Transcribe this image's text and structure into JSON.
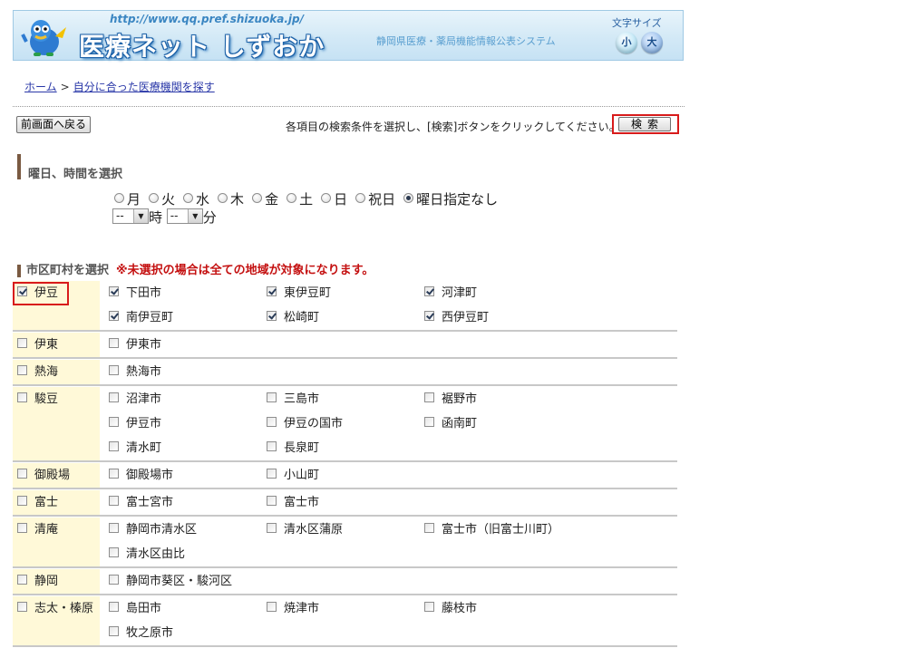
{
  "header": {
    "url": "http://www.qq.pref.shizuoka.jp/",
    "site_title": "医療ネット しずおか",
    "subtitle": "静岡県医療・薬局機能情報公表システム",
    "font_size_label": "文字サイズ",
    "font_small": "小",
    "font_large": "大"
  },
  "breadcrumb": {
    "home": "ホーム",
    "sep": ">",
    "current": "自分に合った医療機関を探す"
  },
  "controls": {
    "back_label": "前画面へ戻る",
    "instruction": "各項目の検索条件を選択し、[検索]ボタンをクリックしてください。→",
    "search_label": "検索"
  },
  "days_section": {
    "heading": "曜日、時間を選択",
    "options": [
      {
        "label": "月",
        "checked": false
      },
      {
        "label": "火",
        "checked": false
      },
      {
        "label": "水",
        "checked": false
      },
      {
        "label": "木",
        "checked": false
      },
      {
        "label": "金",
        "checked": false
      },
      {
        "label": "土",
        "checked": false
      },
      {
        "label": "日",
        "checked": false
      },
      {
        "label": "祝日",
        "checked": false
      },
      {
        "label": "曜日指定なし",
        "checked": true
      }
    ],
    "hour_value": "--",
    "hour_unit": "時",
    "minute_value": "--",
    "minute_unit": "分"
  },
  "area_section": {
    "heading": "市区町村を選択",
    "note": "※未選択の場合は全ての地域が対象になります。",
    "regions": [
      {
        "name": "伊豆",
        "checked": true,
        "munis": [
          {
            "name": "下田市",
            "checked": true
          },
          {
            "name": "東伊豆町",
            "checked": true
          },
          {
            "name": "河津町",
            "checked": true
          },
          {
            "name": "南伊豆町",
            "checked": true
          },
          {
            "name": "松崎町",
            "checked": true
          },
          {
            "name": "西伊豆町",
            "checked": true
          }
        ]
      },
      {
        "name": "伊東",
        "checked": false,
        "munis": [
          {
            "name": "伊東市",
            "checked": false
          }
        ]
      },
      {
        "name": "熱海",
        "checked": false,
        "munis": [
          {
            "name": "熱海市",
            "checked": false
          }
        ]
      },
      {
        "name": "駿豆",
        "checked": false,
        "munis": [
          {
            "name": "沼津市",
            "checked": false
          },
          {
            "name": "三島市",
            "checked": false
          },
          {
            "name": "裾野市",
            "checked": false
          },
          {
            "name": "伊豆市",
            "checked": false
          },
          {
            "name": "伊豆の国市",
            "checked": false
          },
          {
            "name": "函南町",
            "checked": false
          },
          {
            "name": "清水町",
            "checked": false
          },
          {
            "name": "長泉町",
            "checked": false
          }
        ]
      },
      {
        "name": "御殿場",
        "checked": false,
        "munis": [
          {
            "name": "御殿場市",
            "checked": false
          },
          {
            "name": "小山町",
            "checked": false
          }
        ]
      },
      {
        "name": "富士",
        "checked": false,
        "munis": [
          {
            "name": "富士宮市",
            "checked": false
          },
          {
            "name": "富士市",
            "checked": false
          }
        ]
      },
      {
        "name": "清庵",
        "checked": false,
        "munis": [
          {
            "name": "静岡市清水区",
            "checked": false
          },
          {
            "name": "清水区蒲原",
            "checked": false
          },
          {
            "name": "富士市（旧富士川町）",
            "checked": false
          },
          {
            "name": "清水区由比",
            "checked": false
          }
        ]
      },
      {
        "name": "静岡",
        "checked": false,
        "munis": [
          {
            "name": "静岡市葵区・駿河区",
            "checked": false
          }
        ]
      },
      {
        "name": "志太・榛原",
        "checked": false,
        "munis": [
          {
            "name": "島田市",
            "checked": false
          },
          {
            "name": "焼津市",
            "checked": false
          },
          {
            "name": "藤枝市",
            "checked": false
          },
          {
            "name": "牧之原市",
            "checked": false
          }
        ]
      }
    ]
  }
}
